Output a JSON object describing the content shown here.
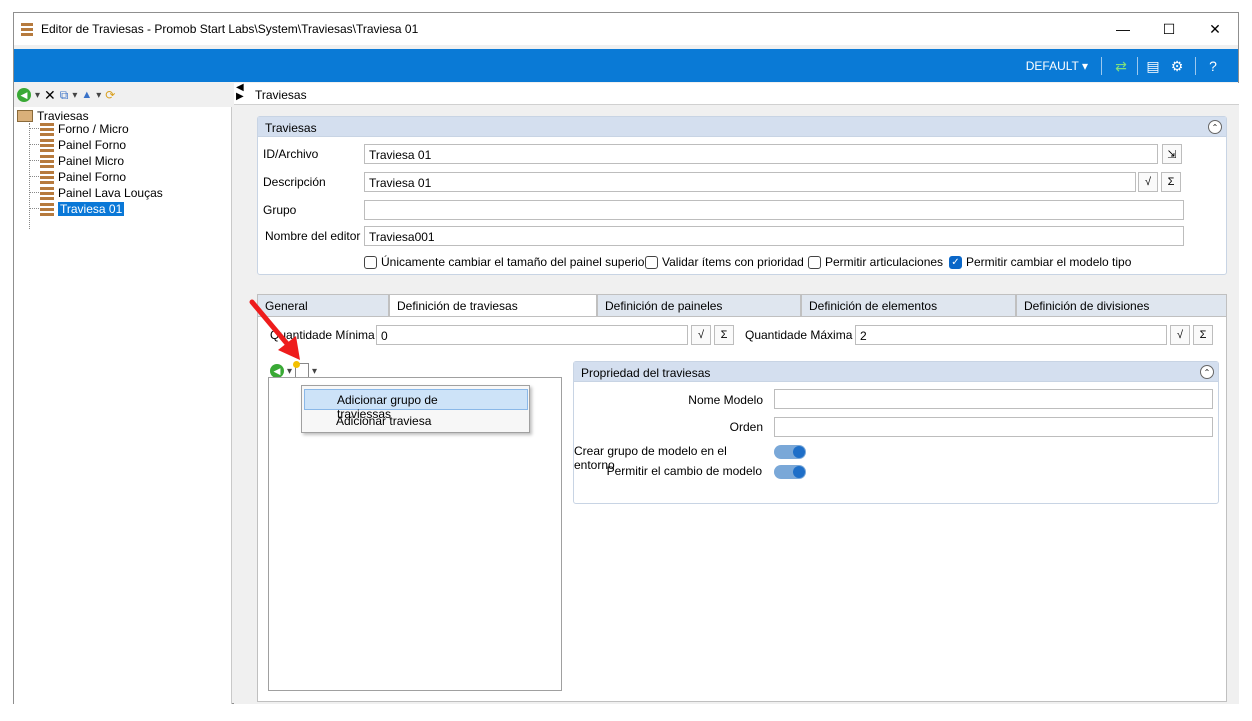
{
  "window": {
    "title": "Editor de Traviesas - Promob Start Labs\\System\\Traviesas\\Traviesa 01",
    "controls": {
      "minimize": "—",
      "maximize": "☐",
      "close": "✕"
    }
  },
  "toolbar": {
    "profile": "DEFAULT ▾",
    "icons": [
      "refresh-icon",
      "panel-icon",
      "settings-icon",
      "help-icon"
    ]
  },
  "tree": {
    "root": "Traviesas",
    "items": [
      "Forno / Micro",
      "Painel Forno",
      "Painel Micro",
      "Painel Forno",
      "Painel Lava Louças",
      "Traviesa 01"
    ],
    "selected_index": 5
  },
  "right": {
    "header": "Traviesas",
    "group_title": "Traviesas",
    "fields": {
      "id_label": "ID/Archivo",
      "id_value": "Traviesa 01",
      "desc_label": "Descripción",
      "desc_value": "Traviesa 01",
      "group_label": "Grupo",
      "group_value": "",
      "editor_label": "Nombre del editor",
      "editor_value": "Traviesa001"
    },
    "checks": [
      {
        "label": "Únicamente cambiar el tamaño del painel superior",
        "checked": false
      },
      {
        "label": "Validar ítems con prioridad",
        "checked": false
      },
      {
        "label": "Permitir articulaciones",
        "checked": false
      },
      {
        "label": "Permitir cambiar el modelo tipo",
        "checked": true
      }
    ],
    "tabs": [
      "General",
      "Definición de traviesas",
      "Definición de paineles",
      "Definición de elementos",
      "Definición de divisiones"
    ],
    "active_tab": 1,
    "qty": {
      "min_label": "Quantidade Mínima",
      "min_value": "0",
      "max_label": "Quantidade Máxima",
      "max_value": "2"
    },
    "menu": [
      "Adicionar grupo de traviessas",
      "Adicionar traviesa"
    ],
    "props": {
      "title": "Propriedad del traviesas",
      "nome_label": "Nome Modelo",
      "nome_value": "",
      "orden_label": "Orden",
      "orden_value": "",
      "crear_label": "Crear grupo de modelo en el entorno",
      "permitir_label": "Permitir el cambio de modelo"
    },
    "sigma": "Σ"
  }
}
